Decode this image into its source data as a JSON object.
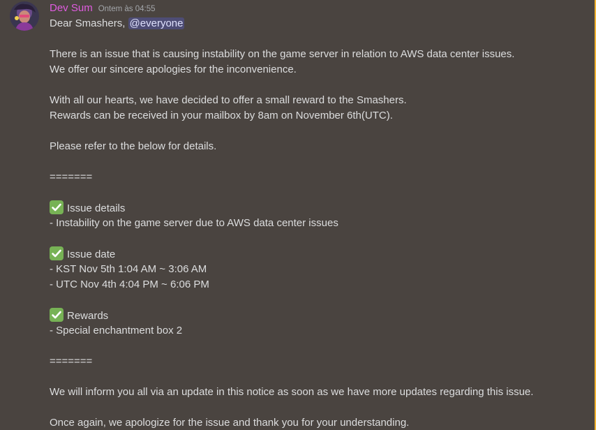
{
  "message": {
    "author": "Dev Sum",
    "timestamp": "Ontem às 04:55",
    "greeting": "Dear Smashers,",
    "mention": "@everyone",
    "line_issue": "There is an issue that is causing instability on the game server in relation to AWS data center issues.",
    "line_apology": "We offer our sincere apologies for the inconvenience.",
    "line_hearts": "With all our hearts, we have decided to offer a small reward to the Smashers.",
    "line_mailbox": "Rewards can be received in your mailbox by 8am on November 6th(UTC).",
    "line_refer": "Please refer to the below for details.",
    "divider": "=======",
    "section_details_title": "Issue details",
    "section_details_1": "- Instability on the game server due to AWS data center issues",
    "section_date_title": "Issue date",
    "section_date_1": "- KST Nov 5th  1:04 AM ~ 3:06 AM",
    "section_date_2": "- UTC Nov 4th 4:04 PM ~ 6:06 PM",
    "section_rewards_title": "Rewards",
    "section_rewards_1": "- Special enchantment box 2",
    "line_inform": "We will inform you all via an update in this notice as soon as we have more updates regarding this issue.",
    "line_closing": "Once again, we apologize for the issue and thank you for your understanding."
  },
  "colors": {
    "background": "#4a4440",
    "username": "#e05ce0",
    "mention_bg": "#5865f2",
    "check_green": "#77b255",
    "highlight_bar": "#f0b232"
  },
  "icons": {
    "check": "white-heavy-check-mark-icon"
  }
}
